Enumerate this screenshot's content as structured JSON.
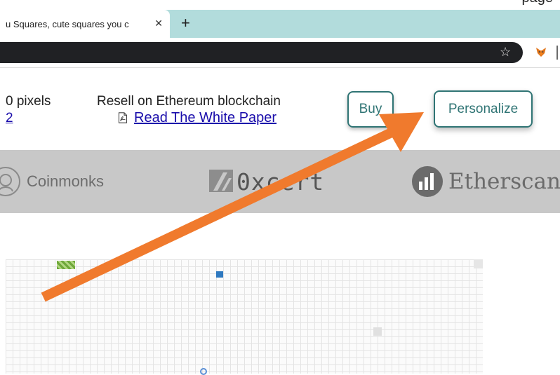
{
  "window": {
    "top_title_fragment": "page",
    "tab_title": "u Squares, cute squares you c",
    "close_symbol": "✕",
    "new_tab_symbol": "+"
  },
  "toolbar": {
    "star_symbol": "☆"
  },
  "header": {
    "pixels_label": "0 pixels",
    "pixels_link": "2",
    "resell_text": "Resell on Ethereum blockchain",
    "white_paper_link": "Read The White Paper",
    "buy_label": "Buy",
    "personalize_label": "Personalize"
  },
  "partners": {
    "coinmonks": "Coinmonks",
    "oxcert": "0xcert",
    "etherscan": "Etherscan"
  },
  "colors": {
    "tab_bar": "#b2dcdc",
    "button_accent": "#2f7474",
    "arrow": "#f07a2d",
    "partner_band": "#c8c8c8"
  }
}
